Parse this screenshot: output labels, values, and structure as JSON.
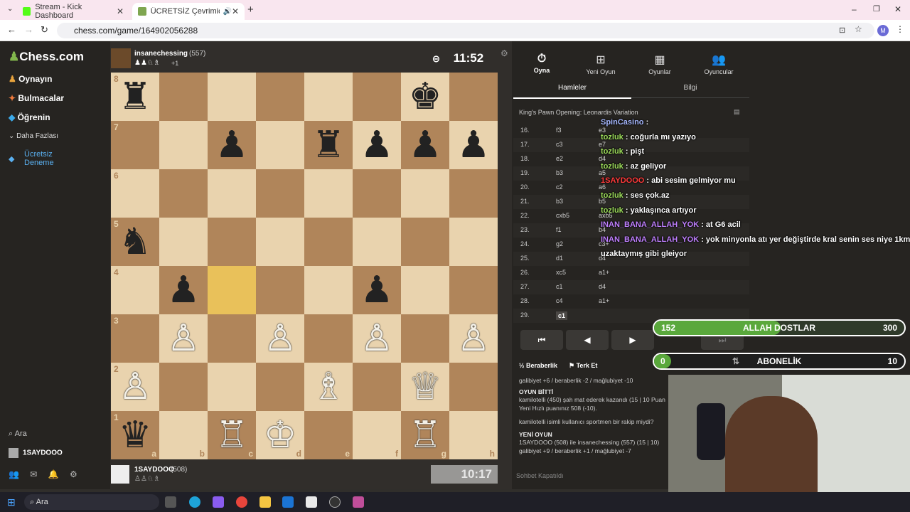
{
  "browser": {
    "tabs": [
      {
        "label": "Stream - Kick Dashboard",
        "active": false
      },
      {
        "label": "ÜCRETSİZ Çevrimiçi Satranç",
        "active": true
      }
    ],
    "url": "chess.com/game/164902056288",
    "profile": "M"
  },
  "nav": {
    "logo": "Chess.com",
    "items": [
      "Oynayın",
      "Bulmacalar",
      "Öğrenin",
      "Daha Fazlası",
      "Ücretsiz Deneme"
    ],
    "search": "Ara",
    "username": "1SAYDOOO"
  },
  "game": {
    "top_player": {
      "name": "insanechessing",
      "rating": "(557)",
      "extra": "+1"
    },
    "top_clock": "11:52",
    "bottom_player": {
      "name": "1SAYDOOO",
      "rating": "(508)"
    },
    "bottom_clock": "10:17",
    "board": [
      [
        "♜",
        "",
        "",
        "",
        "",
        "",
        "♚",
        ""
      ],
      [
        "",
        "",
        "♟",
        "",
        "♜",
        "♟",
        "♟",
        "♟"
      ],
      [
        "",
        "",
        "",
        "",
        "",
        "",
        "",
        ""
      ],
      [
        "♞",
        "",
        "",
        "",
        "",
        "",
        "",
        ""
      ],
      [
        "",
        "♟",
        "",
        "",
        "",
        "♟",
        "",
        ""
      ],
      [
        "",
        "♙",
        "",
        "♙",
        "",
        "♙",
        "",
        "♙"
      ],
      [
        "♙",
        "",
        "",
        "",
        "♗",
        "",
        "♕",
        ""
      ],
      [
        "♛",
        "",
        "♖",
        "♔",
        "",
        "",
        "♖",
        ""
      ]
    ],
    "white_squares": [
      "b3",
      "d3",
      "f3",
      "h3",
      "a2",
      "e2",
      "g2",
      "c1",
      "d1",
      "g1"
    ],
    "highlight": "c4",
    "ranks": [
      "8",
      "7",
      "6",
      "5",
      "4",
      "3",
      "2",
      "1"
    ],
    "files": [
      "a",
      "b",
      "c",
      "d",
      "e",
      "f",
      "g",
      "h"
    ]
  },
  "panel": {
    "tabs": [
      "Oyna",
      "Yeni Oyun",
      "Oyunlar",
      "Oyuncular"
    ],
    "subtabs": [
      "Hamleler",
      "Bilgi"
    ],
    "opening": "King's Pawn Opening: Leonardis Variation",
    "moves": [
      [
        "16.",
        "f3",
        "e3"
      ],
      [
        "17.",
        "c3",
        "e7"
      ],
      [
        "18.",
        "e2",
        "d4"
      ],
      [
        "19.",
        "b3",
        "a5"
      ],
      [
        "20.",
        "c2",
        "a6"
      ],
      [
        "21.",
        "b3",
        "b5"
      ],
      [
        "22.",
        "cxb5",
        "axb5"
      ],
      [
        "23.",
        "f1",
        "b4"
      ],
      [
        "24.",
        "g2",
        "c3+"
      ],
      [
        "25.",
        "d1",
        "d4"
      ],
      [
        "26.",
        "xc5",
        "a1+"
      ],
      [
        "27.",
        "c1",
        "d4"
      ],
      [
        "28.",
        "c4",
        "a1+"
      ],
      [
        "29.",
        "c1",
        ""
      ]
    ],
    "draw_label": "Beraberlik",
    "resign_label": "Terk Et",
    "log": [
      "galibiyet +6 / beraberlik -2 / mağlubiyet -10",
      "OYUN BİTTİ",
      "kamilotelli (450) şah mat ederek kazandı (15 | 10 Puan",
      "Yeni Hızlı puanınız 508 (-10).",
      "kamilotelli isimli kullanıcı sportmen bir rakip miydi?",
      "YENİ OYUN",
      "1SAYDOOO (508) ile insanechessing (557) (15 | 10)",
      "galibiyet +9 / beraberlik +1 / mağlubiyet -7"
    ],
    "chat_closed": "Sohbet Kapatıldı"
  },
  "overlay": {
    "chat": [
      {
        "user": "SpinCasino",
        "msg": "",
        "color": "blue"
      },
      {
        "user": "tozluk",
        "msg": "coğurla mı yazıyo",
        "color": "green"
      },
      {
        "user": "tozluk",
        "msg": "pişt",
        "color": "green"
      },
      {
        "user": "tozluk",
        "msg": "az geliyor",
        "color": "green"
      },
      {
        "user": "1SAYDOOO",
        "msg": "abi sesim gelmiyor mu",
        "color": "red"
      },
      {
        "user": "tozluk",
        "msg": "ses çok.az",
        "color": "green"
      },
      {
        "user": "tozluk",
        "msg": "yaklaşınca artıyor",
        "color": "green"
      },
      {
        "user": "INAN_BANA_ALLAH_YOK",
        "msg": "at G6 acil",
        "color": "purple"
      },
      {
        "user": "INAN_BANA_ALLAH_YOK",
        "msg": "yok minyonla atı yer değiştirde kral senin ses niye 1km",
        "color": "purple"
      },
      {
        "user": "",
        "msg": "uzaktaymış gibi gleiyor",
        "color": "white"
      }
    ],
    "goal1": {
      "value": "152",
      "label": "ALLAH DOSTLAR",
      "target": "300",
      "fill": 0.507
    },
    "goal2": {
      "value": "0",
      "label": "ABONELİK",
      "target": "10",
      "fill": 0
    }
  },
  "taskbar": {
    "search": "Ara"
  }
}
